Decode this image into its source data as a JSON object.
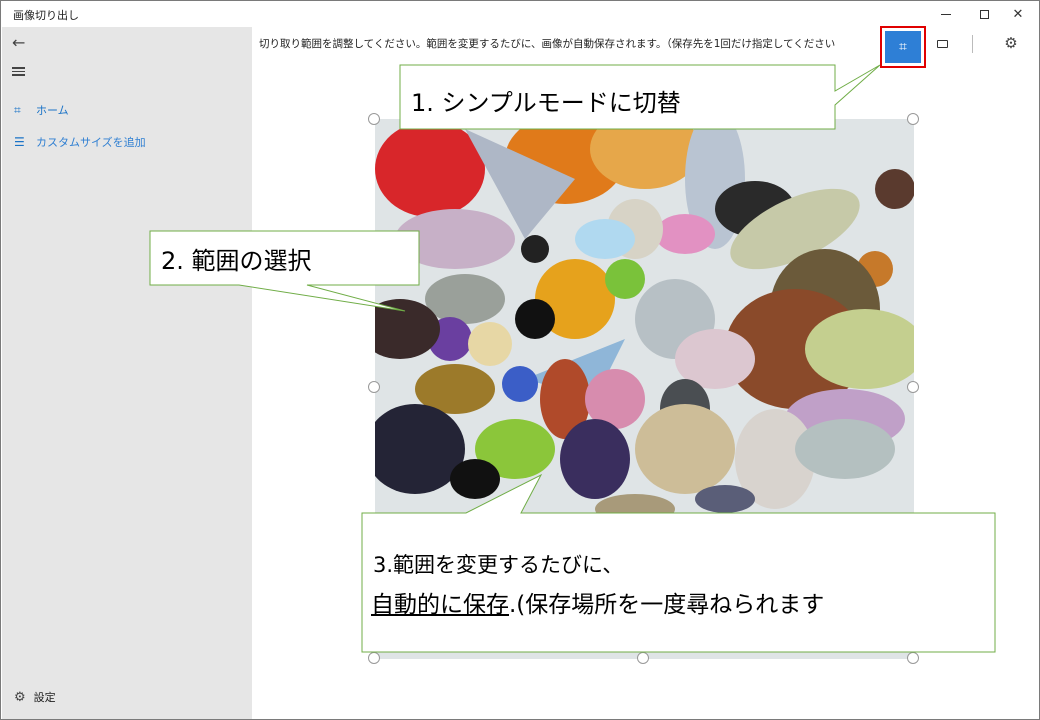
{
  "window": {
    "title": "画像切り出し"
  },
  "sidebar": {
    "items": [
      {
        "label": "ホーム"
      },
      {
        "label": "カスタムサイズを追加"
      }
    ],
    "settings_label": "設定"
  },
  "toolbar": {
    "instruction": "切り取り範囲を調整してください。範囲を変更するたびに、画像が自動保存されます。（保存先を1回だけ指定してください"
  },
  "callouts": {
    "c1": "1. シンプルモードに切替",
    "c2": "2. 範囲の選択",
    "c3_line1": "3.範囲を変更するたびに、",
    "c3_underlined": "自動的に保存",
    "c3_rest": ".(保存場所を一度尋ねられます"
  },
  "colors": {
    "accent": "#2e7fd6",
    "highlight_border": "#e00000",
    "sidebar_bg": "#e6e6e6",
    "callout_border": "#70ad47"
  },
  "icons": {
    "back": "arrow-left-icon",
    "menu": "hamburger-icon",
    "home": "crop-icon",
    "custom": "list-icon",
    "settings": "gear-icon",
    "mode": "window-icon"
  }
}
